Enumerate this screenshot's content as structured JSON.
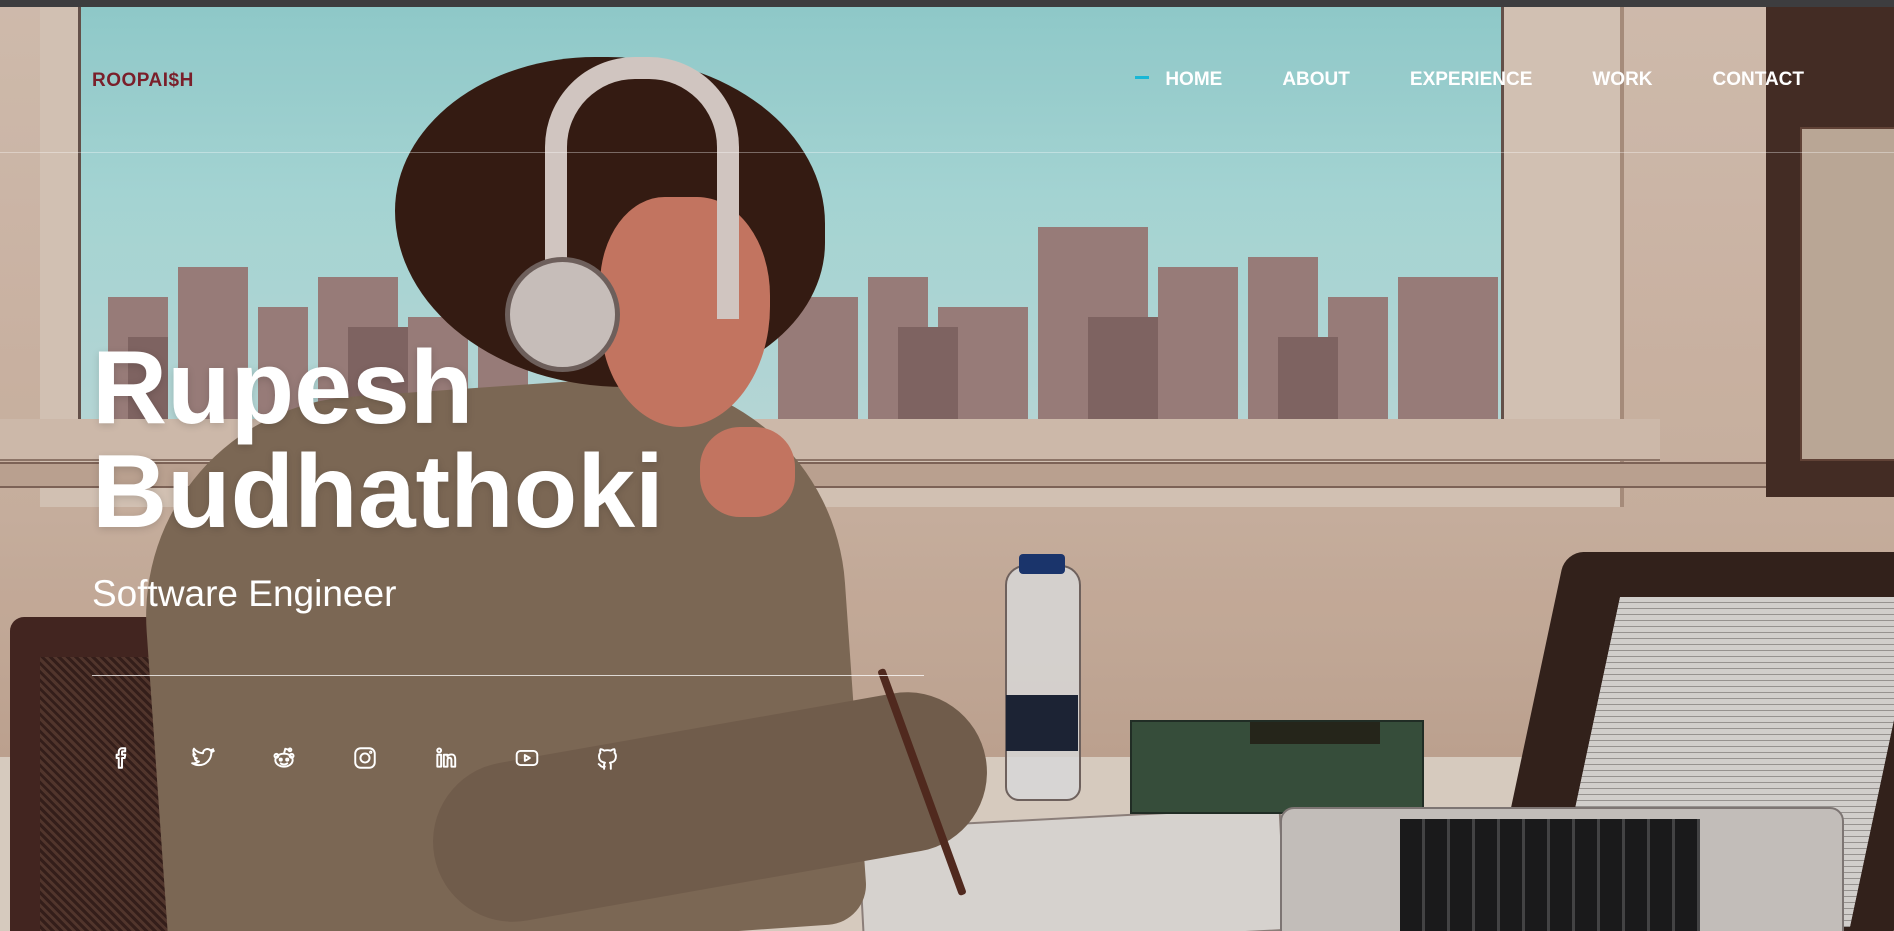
{
  "brand": {
    "logo": "ROOPAI$H"
  },
  "nav": {
    "items": [
      {
        "label": "HOME",
        "active": true
      },
      {
        "label": "ABOUT"
      },
      {
        "label": "EXPERIENCE"
      },
      {
        "label": "WORK"
      },
      {
        "label": "CONTACT"
      }
    ],
    "active_color": "#19b7d6"
  },
  "hero": {
    "first_name": "Rupesh",
    "last_name": "Budhathoki",
    "role": "Software Engineer"
  },
  "socials": [
    {
      "icon": "facebook-icon"
    },
    {
      "icon": "twitter-icon"
    },
    {
      "icon": "reddit-icon"
    },
    {
      "icon": "instagram-icon"
    },
    {
      "icon": "linkedin-icon"
    },
    {
      "icon": "youtube-icon"
    },
    {
      "icon": "github-icon"
    }
  ],
  "colors": {
    "logo": "#7a1f2a",
    "text": "#ffffff",
    "topbar": "#3d3d3f"
  }
}
